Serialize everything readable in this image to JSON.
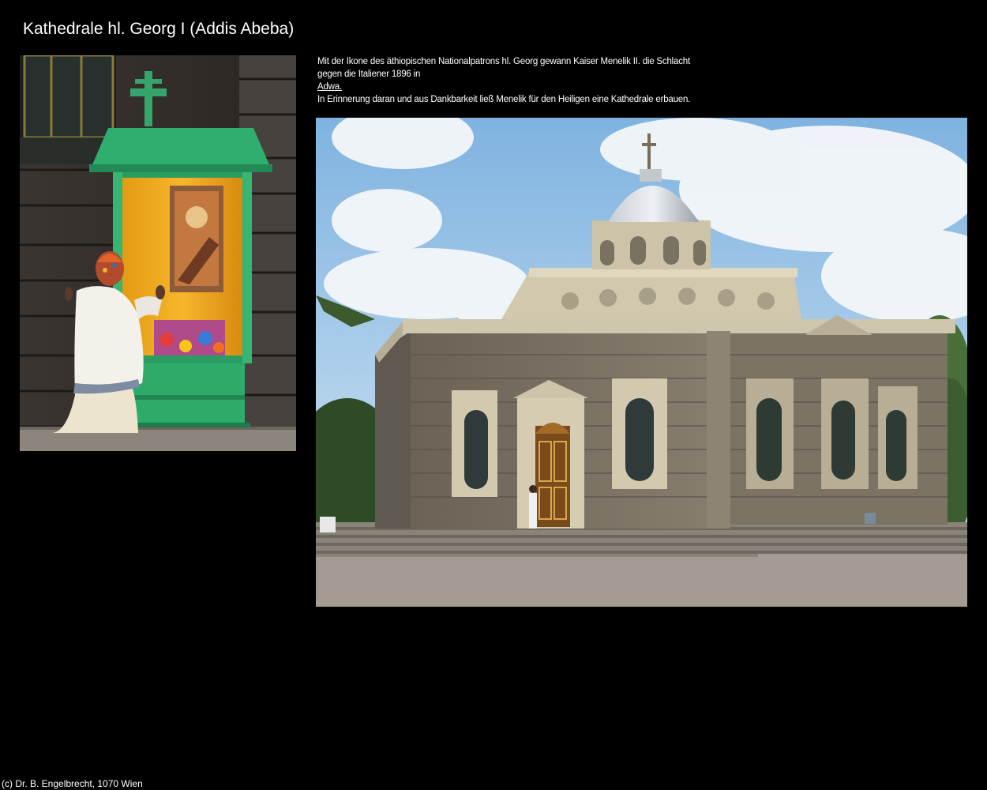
{
  "page": {
    "title": "Kathedrale hl. Georg I (Addis Abeba)"
  },
  "caption": {
    "line1": "Mit der Ikone des äthiopischen Nationalpatrons hl. Georg gewann Kaiser Menelik II. die Schlacht",
    "line2": "gegen die Italiener 1896 in",
    "link_text": "Adwa.",
    "line3": "In Erinnerung daran und aus Dankbarkeit ließ Menelik für den Heiligen eine Kathedrale erbauen."
  },
  "footer": {
    "copyright": "(c) Dr. B. Engelbrecht, 1070 Wien"
  },
  "colors": {
    "background": "#000000",
    "text": "#ffffff",
    "shrine_green": "#2fa86a",
    "sky": "#a9cde8",
    "stone": "#7a7466"
  }
}
